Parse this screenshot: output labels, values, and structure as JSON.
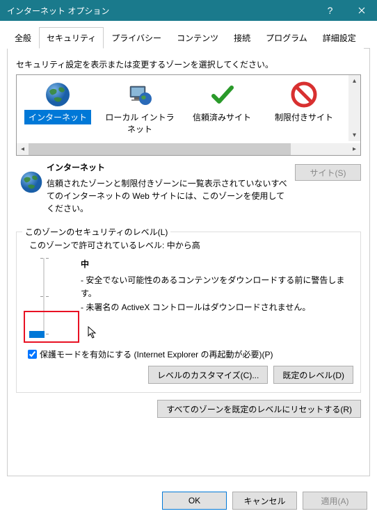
{
  "title": "インターネット オプション",
  "tabs": [
    "全般",
    "セキュリティ",
    "プライバシー",
    "コンテンツ",
    "接続",
    "プログラム",
    "詳細設定"
  ],
  "activeTab": 1,
  "zoneSelectLabel": "セキュリティ設定を表示または変更するゾーンを選択してください。",
  "zones": [
    {
      "name": "インターネット"
    },
    {
      "name": "ローカル イントラネット"
    },
    {
      "name": "信頼済みサイト"
    },
    {
      "name": "制限付きサイト"
    }
  ],
  "zoneDetail": {
    "title": "インターネット",
    "desc": "信頼されたゾーンと制限付きゾーンに一覧表示されていないすべてのインターネットの Web サイトには、このゾーンを使用してください。"
  },
  "sitesBtn": "サイト(S)",
  "levelGroup": "このゾーンのセキュリティのレベル(L)",
  "allowedLabel": "このゾーンで許可されているレベル: 中から高",
  "level": {
    "name": "中",
    "line1": "- 安全でない可能性のあるコンテンツをダウンロードする前に警告します。",
    "line2": "- 未署名の ActiveX コントロールはダウンロードされません。"
  },
  "protectedMode": "保護モードを有効にする (Internet Explorer の再起動が必要)(P)",
  "customizeBtn": "レベルのカスタマイズ(C)...",
  "defaultLevelBtn": "既定のレベル(D)",
  "resetAllBtn": "すべてのゾーンを既定のレベルにリセットする(R)",
  "okBtn": "OK",
  "cancelBtn": "キャンセル",
  "applyBtn": "適用(A)"
}
